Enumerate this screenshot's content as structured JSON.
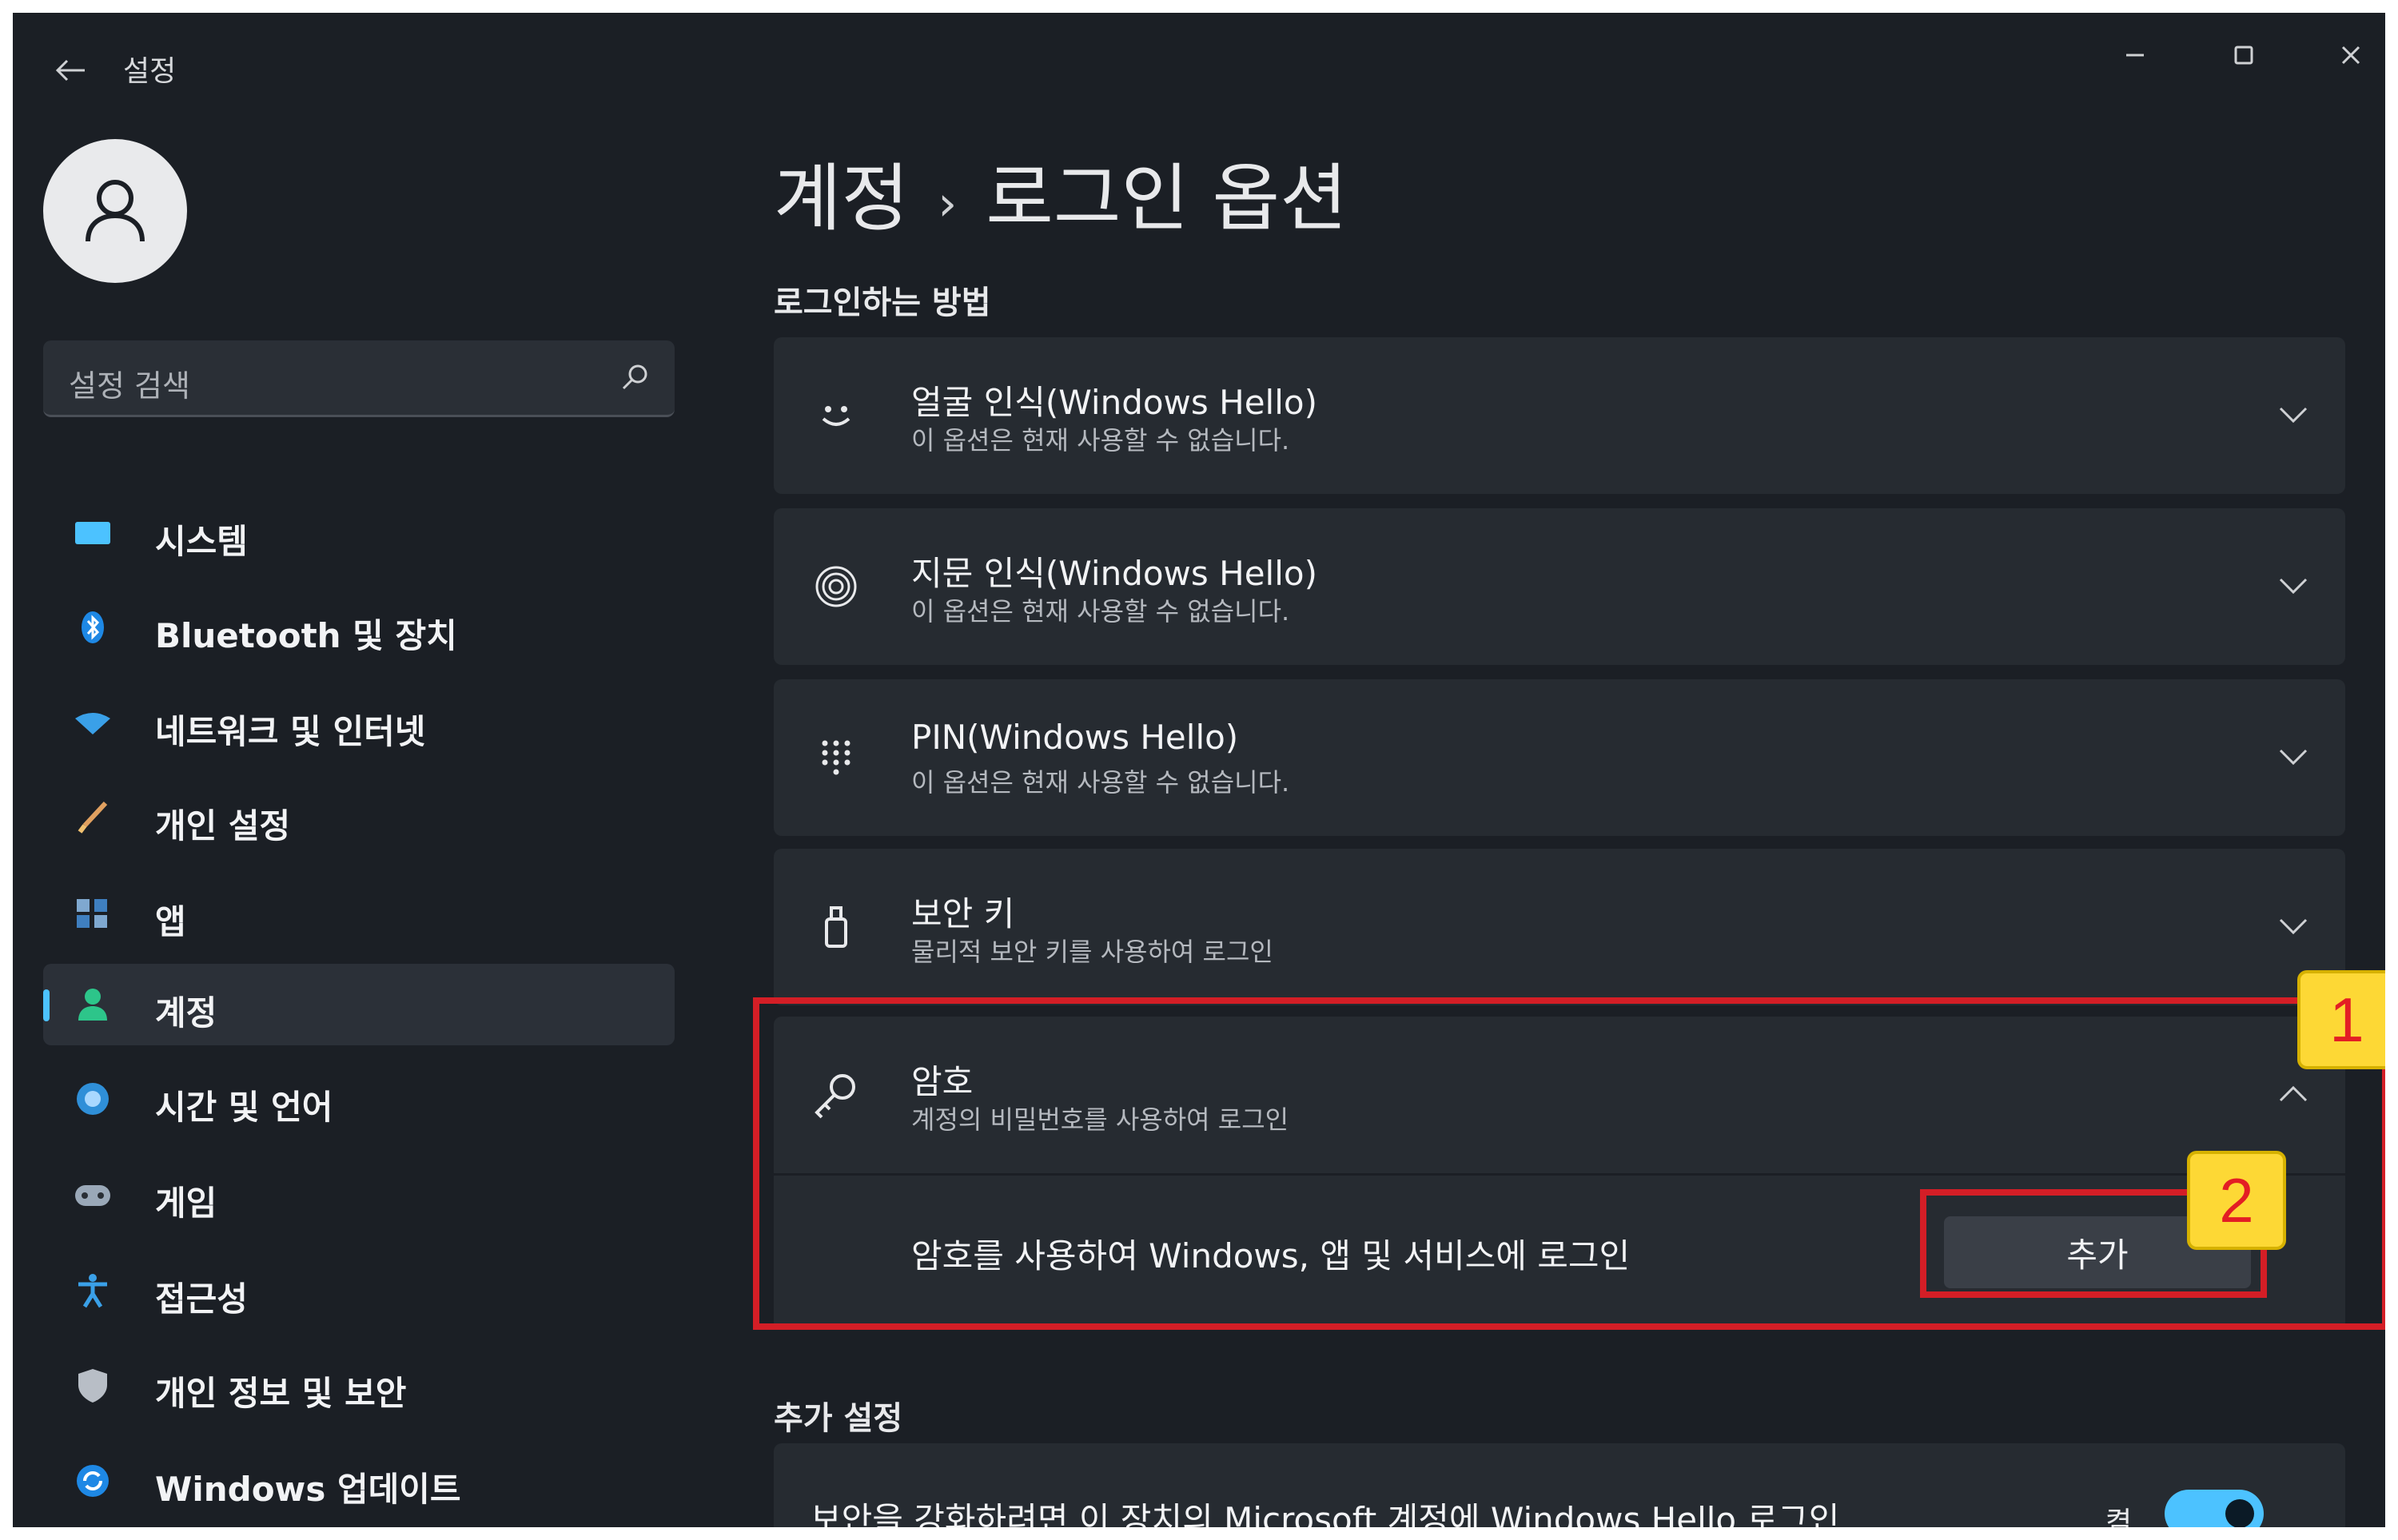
{
  "window": {
    "title": "설정",
    "accent": "#4cc2ff"
  },
  "search": {
    "placeholder": "설정 검색"
  },
  "sidebar": {
    "items": [
      {
        "label": "시스템",
        "icon": "system-icon"
      },
      {
        "label": "Bluetooth 및 장치",
        "icon": "bluetooth-icon"
      },
      {
        "label": "네트워크 및 인터넷",
        "icon": "network-icon"
      },
      {
        "label": "개인 설정",
        "icon": "brush-icon"
      },
      {
        "label": "앱",
        "icon": "apps-icon"
      },
      {
        "label": "계정",
        "icon": "account-icon",
        "selected": true
      },
      {
        "label": "시간 및 언어",
        "icon": "globe-icon"
      },
      {
        "label": "게임",
        "icon": "gamepad-icon"
      },
      {
        "label": "접근성",
        "icon": "accessibility-icon"
      },
      {
        "label": "개인 정보 및 보안",
        "icon": "shield-icon"
      },
      {
        "label": "Windows 업데이트",
        "icon": "update-icon"
      }
    ]
  },
  "page": {
    "breadcrumb_parent": "계정",
    "breadcrumb_sep": "›",
    "title": "로그인 옵션"
  },
  "sections": {
    "signin_methods": "로그인하는 방법",
    "additional": "추가 설정"
  },
  "options": [
    {
      "title": "얼굴 인식(Windows Hello)",
      "subtitle": "이 옵션은 현재 사용할 수 없습니다.",
      "icon": "face-icon"
    },
    {
      "title": "지문 인식(Windows Hello)",
      "subtitle": "이 옵션은 현재 사용할 수 없습니다.",
      "icon": "fingerprint-icon"
    },
    {
      "title": "PIN(Windows Hello)",
      "subtitle": "이 옵션은 현재 사용할 수 없습니다.",
      "icon": "pin-keypad-icon"
    },
    {
      "title": "보안 키",
      "subtitle": "물리적 보안 키를 사용하여 로그인",
      "icon": "security-key-icon"
    }
  ],
  "password": {
    "title": "암호",
    "subtitle": "계정의 비밀번호를 사용하여 로그인",
    "description": "암호를 사용하여 Windows, 앱 및 서비스에 로그인",
    "add_label": "추가",
    "icon": "key-icon",
    "expanded": true
  },
  "annotations": {
    "badge1": "1",
    "badge2": "2",
    "color": "#d41e26"
  },
  "additional": {
    "hello_text": "보안을 강화하려면 이 장치의 Microsoft 계정에 Windows Hello 로그인",
    "toggle_state": "켬",
    "toggle_on": true
  }
}
